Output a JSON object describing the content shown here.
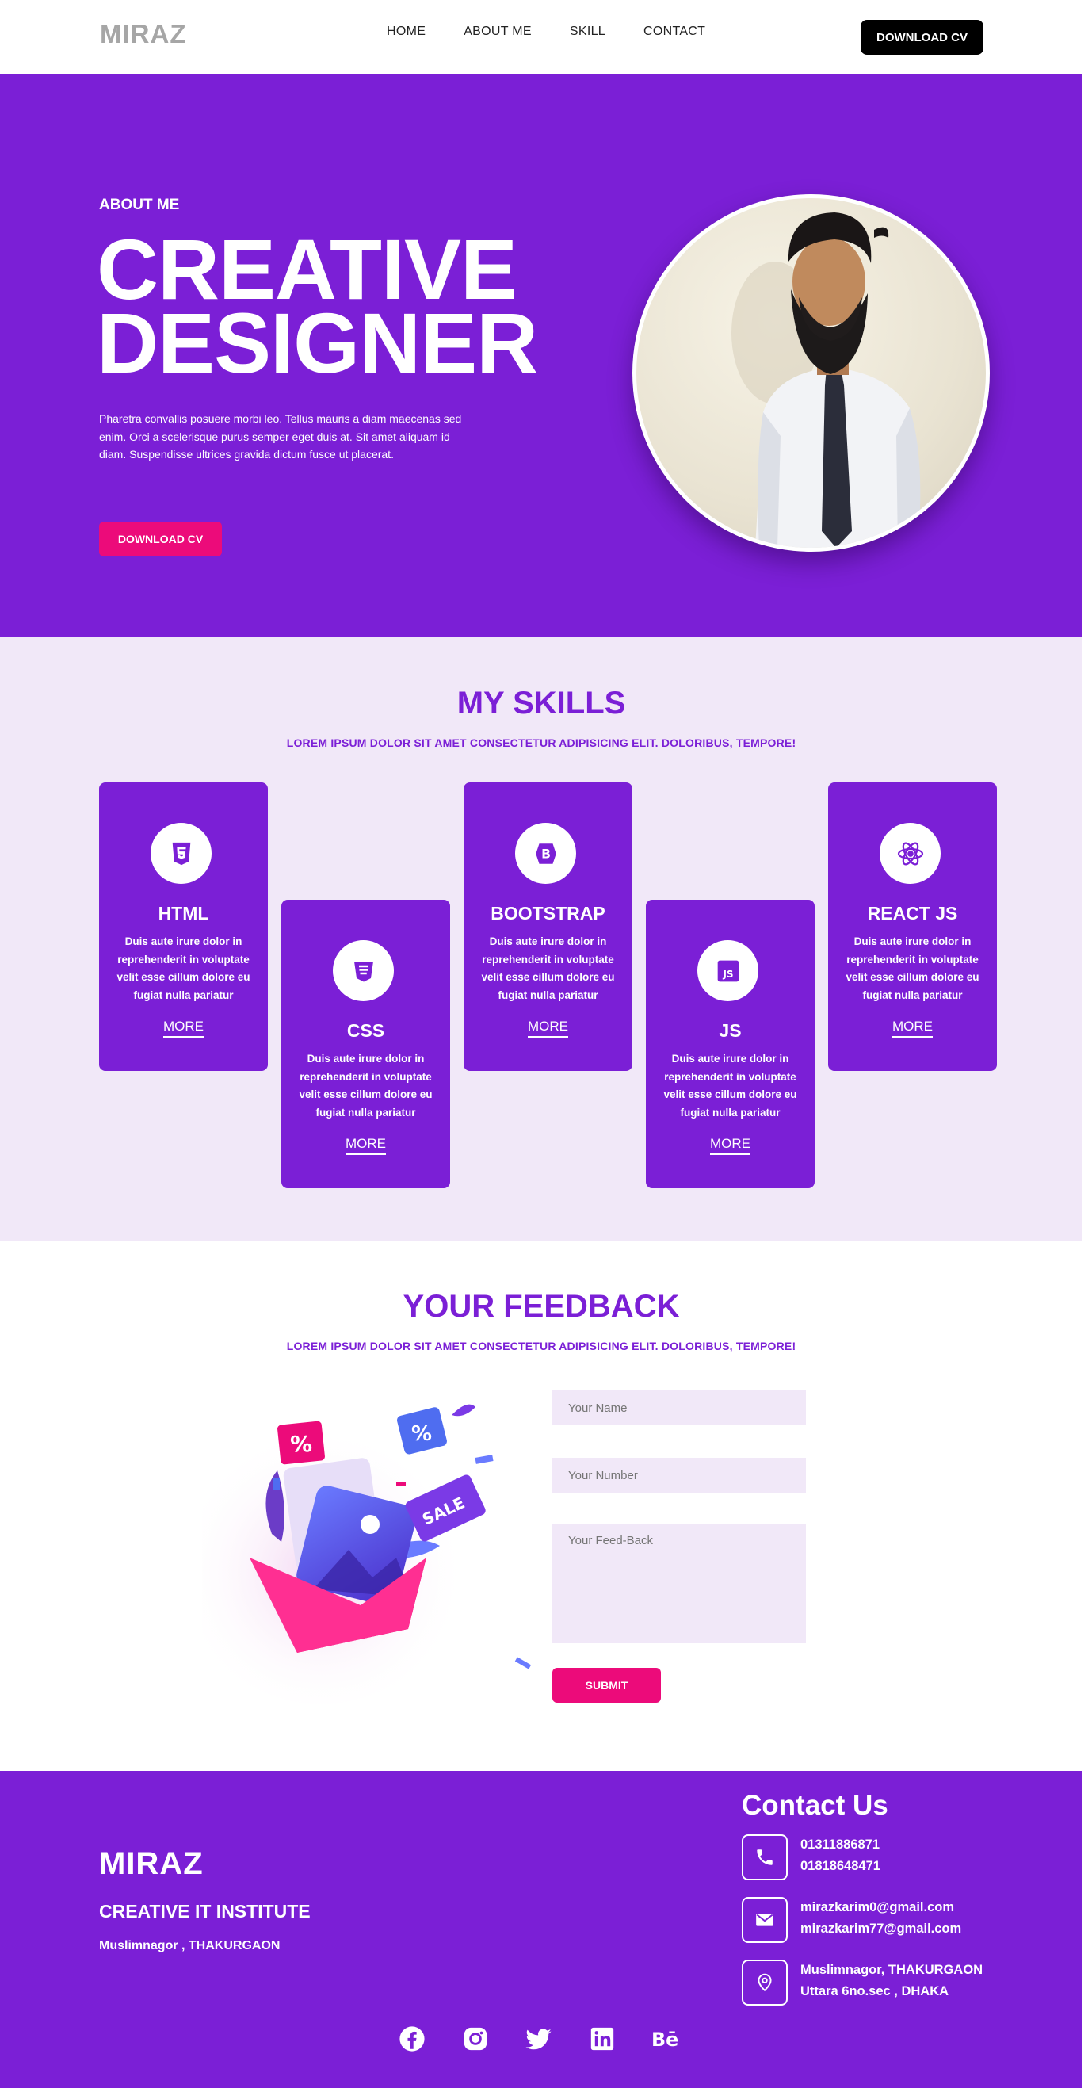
{
  "nav": {
    "logo": "MIRAZ",
    "links": [
      "HOME",
      "ABOUT ME",
      "SKILL",
      "CONTACT"
    ],
    "cta": "DOWNLOAD CV"
  },
  "hero": {
    "kicker": "ABOUT ME",
    "title_line1": "CREATIVE",
    "title_line2": "DESIGNER",
    "text": "Pharetra convallis posuere morbi leo. Tellus mauris a diam maecenas sed enim. Orci a scelerisque purus semper eget duis at. Sit amet aliquam id diam. Suspendisse ultrices gravida dictum fusce ut placerat.",
    "cta": "DOWNLOAD CV"
  },
  "skills": {
    "title": "MY SKILLS",
    "subtitle": "LOREM IPSUM DOLOR SIT AMET CONSECTETUR ADIPISICING ELIT. DOLORIBUS, TEMPORE!",
    "cards": [
      {
        "title": "HTML",
        "icon": "html5-icon",
        "desc": "Duis aute irure dolor in reprehenderit in voluptate velit esse cillum dolore eu fugiat nulla pariatur",
        "more": "MORE"
      },
      {
        "title": "CSS",
        "icon": "css3-icon",
        "desc": "Duis aute irure dolor in reprehenderit in voluptate velit esse cillum dolore eu fugiat nulla pariatur",
        "more": "MORE"
      },
      {
        "title": "BOOTSTRAP",
        "icon": "bootstrap-icon",
        "desc": "Duis aute irure dolor in reprehenderit in voluptate velit esse cillum dolore eu fugiat nulla pariatur",
        "more": "MORE"
      },
      {
        "title": "JS",
        "icon": "javascript-icon",
        "desc": "Duis aute irure dolor in reprehenderit in voluptate velit esse cillum dolore eu fugiat nulla pariatur",
        "more": "MORE"
      },
      {
        "title": "REACT JS",
        "icon": "react-icon",
        "desc": "Duis aute irure dolor in reprehenderit in voluptate velit esse cillum dolore eu fugiat nulla pariatur",
        "more": "MORE"
      }
    ]
  },
  "feedback": {
    "title": "YOUR FEEDBACK",
    "subtitle": "LOREM IPSUM DOLOR SIT AMET CONSECTETUR ADIPISICING ELIT. DOLORIBUS, TEMPORE!",
    "name_placeholder": "Your Name",
    "number_placeholder": "Your Number",
    "feedback_placeholder": "Your Feed-Back",
    "submit": "SUBMIT",
    "illustration": {
      "badge1": "%",
      "badge2": "%",
      "sale": "SALE"
    }
  },
  "footer": {
    "logo": "MIRAZ",
    "institute": "CREATIVE IT INSTITUTE",
    "address": "Muslimnagor , THAKURGAON",
    "contact_title": "Contact Us",
    "phone1": "01311886871",
    "phone2": "01818648471",
    "email1": "mirazkarim0@gmail.com",
    "email2": "mirazkarim77@gmail.com",
    "location1": "Muslimnagor, THAKURGAON",
    "location2": "Uttara 6no.sec , DHAKA",
    "socials": [
      "facebook-icon",
      "instagram-icon",
      "twitter-icon",
      "linkedin-icon",
      "behance-icon"
    ]
  },
  "colors": {
    "primary": "#7b1fd6",
    "accent": "#ec0b7a",
    "light": "#f1e8f8"
  }
}
